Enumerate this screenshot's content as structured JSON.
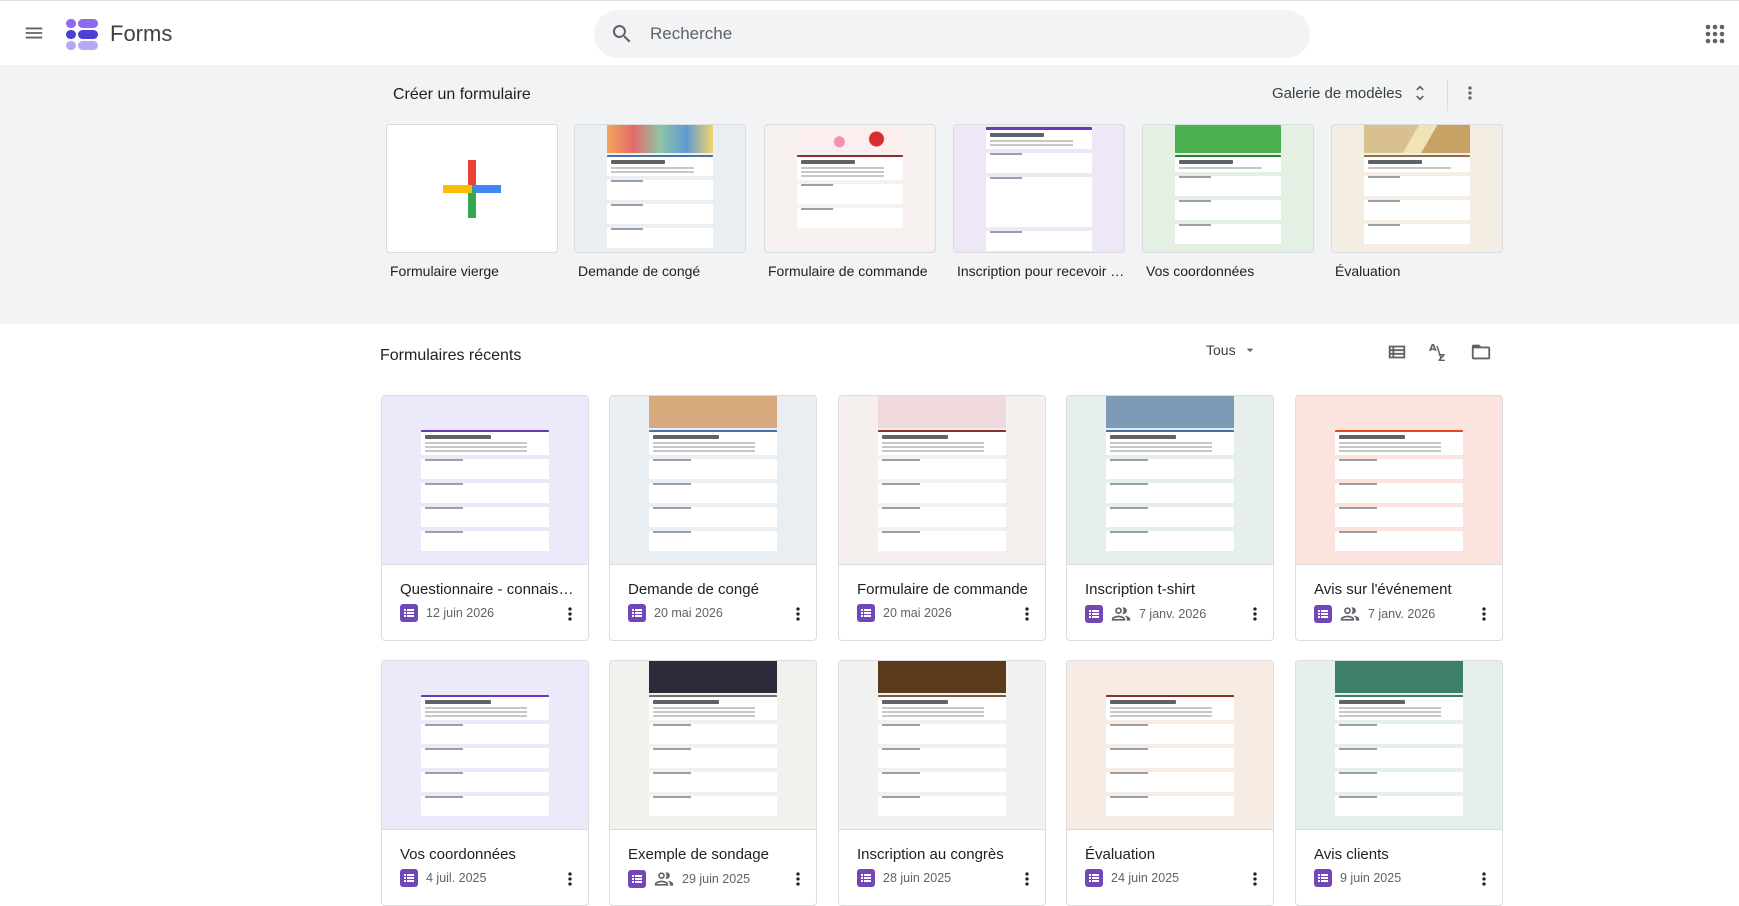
{
  "header": {
    "app_name": "Forms",
    "search_placeholder": "Recherche"
  },
  "templates": {
    "title": "Créer un formulaire",
    "gallery_label": "Galerie de modèles",
    "items": [
      {
        "label": "Formulaire vierge"
      },
      {
        "label": "Demande de congé",
        "banner_color": "#e0b48c"
      },
      {
        "label": "Formulaire de commande",
        "banner_color": "#f4e6e8"
      },
      {
        "label": "Inscription pour recevoir un t-shirt",
        "banner_color": "#673ab7"
      },
      {
        "label": "Vos coordonnées",
        "banner_color": "#43a047"
      },
      {
        "label": "Évaluation",
        "banner_color": "#c8b28a"
      }
    ]
  },
  "recent": {
    "title": "Formulaires récents",
    "owner_filter": "Tous",
    "forms": [
      {
        "title": "Questionnaire - connaissances en géographie",
        "date": "12 juin 2026",
        "shared": false,
        "bg": "#ece9fb",
        "banner": "#ece9fb",
        "accent": "#673ab7"
      },
      {
        "title": "Demande de congé",
        "date": "20 mai 2026",
        "shared": false,
        "bg": "#e8eef2",
        "banner": "#d9a97e",
        "accent": "#4a6ea8"
      },
      {
        "title": "Formulaire de commande",
        "date": "20 mai 2026",
        "shared": false,
        "bg": "#f5efee",
        "banner": "#f0d9dc",
        "accent": "#8b2e2e"
      },
      {
        "title": "Inscription t-shirt",
        "date": "7 janv. 2026",
        "shared": true,
        "bg": "#e6efee",
        "banner": "#7d9bb5",
        "accent": "#3f6fa6"
      },
      {
        "title": "Avis sur l'événement",
        "date": "7 janv. 2026",
        "shared": true,
        "bg": "#fce3dd",
        "banner": "#fce3dd",
        "accent": "#e64a19"
      },
      {
        "title": "Vos coordonnées",
        "date": "4 juil. 2025",
        "shared": false,
        "bg": "#ece9fb",
        "banner": "#ece9fb",
        "accent": "#673ab7"
      },
      {
        "title": "Exemple de sondage",
        "date": "29 juin 2025",
        "shared": true,
        "bg": "#f3f1ee",
        "banner": "#2b2b3a",
        "accent": "#6d6d6d"
      },
      {
        "title": "Inscription au congrès",
        "date": "28 juin 2025",
        "shared": false,
        "bg": "#f1f1f1",
        "banner": "#5a3b1c",
        "accent": "#795548"
      },
      {
        "title": "Évaluation",
        "date": "24 juin 2025",
        "shared": false,
        "bg": "#f6ece4",
        "banner": "#f6ece4",
        "accent": "#8d2f1f"
      },
      {
        "title": "Avis clients",
        "date": "9 juin 2025",
        "shared": false,
        "bg": "#e5efec",
        "banner": "#3e7f6a",
        "accent": "#3e7f6a"
      }
    ]
  },
  "colors": {
    "forms_purple": "#7248b9",
    "band_bg": "#f1f3f4"
  }
}
